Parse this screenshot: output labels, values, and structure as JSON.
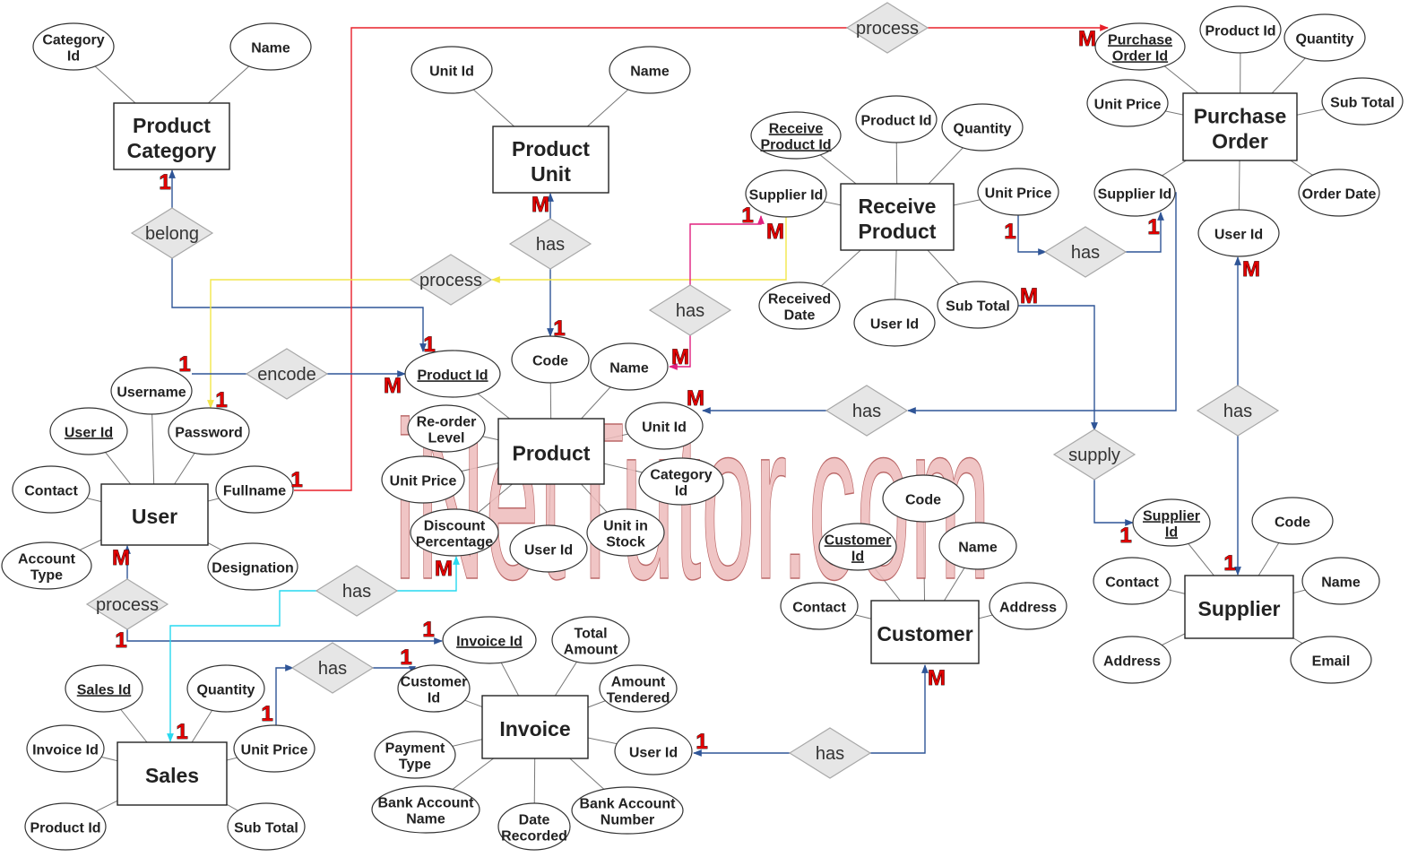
{
  "diagram": {
    "watermark": "iNetTutor.com",
    "colors": {
      "connector": "#2F5597",
      "red_connector": "#E8202A",
      "yellow_connector": "#F2E64A",
      "magenta_connector": "#E0207F",
      "cyan_connector": "#27D9F0",
      "cardinality": "#E00000"
    },
    "entities": [
      {
        "id": "product_category",
        "label": [
          "Product",
          "Category"
        ]
      },
      {
        "id": "product_unit",
        "label": [
          "Product",
          "Unit"
        ]
      },
      {
        "id": "receive_product",
        "label": [
          "Receive",
          "Product"
        ]
      },
      {
        "id": "purchase_order",
        "label": [
          "Purchase",
          "Order"
        ]
      },
      {
        "id": "product",
        "label": [
          "Product"
        ]
      },
      {
        "id": "user",
        "label": [
          "User"
        ]
      },
      {
        "id": "customer",
        "label": [
          "Customer"
        ]
      },
      {
        "id": "supplier",
        "label": [
          "Supplier"
        ]
      },
      {
        "id": "invoice",
        "label": [
          "Invoice"
        ]
      },
      {
        "id": "sales",
        "label": [
          "Sales"
        ]
      }
    ],
    "attributes": [
      {
        "id": "pc_cat_id",
        "entity": "product_category",
        "label": [
          "Category",
          "Id"
        ],
        "key": false
      },
      {
        "id": "pc_name",
        "entity": "product_category",
        "label": [
          "Name"
        ],
        "key": false
      },
      {
        "id": "pu_unit_id",
        "entity": "product_unit",
        "label": [
          "Unit Id"
        ],
        "key": false
      },
      {
        "id": "pu_name",
        "entity": "product_unit",
        "label": [
          "Name"
        ],
        "key": false
      },
      {
        "id": "rp_id",
        "entity": "receive_product",
        "label": [
          "Receive",
          "Product Id"
        ],
        "key": true
      },
      {
        "id": "rp_product_id",
        "entity": "receive_product",
        "label": [
          "Product Id"
        ],
        "key": false
      },
      {
        "id": "rp_qty",
        "entity": "receive_product",
        "label": [
          "Quantity"
        ],
        "key": false
      },
      {
        "id": "rp_supplier_id",
        "entity": "receive_product",
        "label": [
          "Supplier Id"
        ],
        "key": false
      },
      {
        "id": "rp_unit_price",
        "entity": "receive_product",
        "label": [
          "Unit Price"
        ],
        "key": false
      },
      {
        "id": "rp_received_date",
        "entity": "receive_product",
        "label": [
          "Received",
          "Date"
        ],
        "key": false
      },
      {
        "id": "rp_user_id",
        "entity": "receive_product",
        "label": [
          "User Id"
        ],
        "key": false
      },
      {
        "id": "rp_sub_total",
        "entity": "receive_product",
        "label": [
          "Sub Total"
        ],
        "key": false
      },
      {
        "id": "po_id",
        "entity": "purchase_order",
        "label": [
          "Purchase",
          "Order Id"
        ],
        "key": true
      },
      {
        "id": "po_product_id",
        "entity": "purchase_order",
        "label": [
          "Product Id"
        ],
        "key": false
      },
      {
        "id": "po_qty",
        "entity": "purchase_order",
        "label": [
          "Quantity"
        ],
        "key": false
      },
      {
        "id": "po_unit_price",
        "entity": "purchase_order",
        "label": [
          "Unit Price"
        ],
        "key": false
      },
      {
        "id": "po_sub_total",
        "entity": "purchase_order",
        "label": [
          "Sub Total"
        ],
        "key": false
      },
      {
        "id": "po_supplier_id",
        "entity": "purchase_order",
        "label": [
          "Supplier Id"
        ],
        "key": false
      },
      {
        "id": "po_order_date",
        "entity": "purchase_order",
        "label": [
          "Order Date"
        ],
        "key": false
      },
      {
        "id": "po_user_id",
        "entity": "purchase_order",
        "label": [
          "User Id"
        ],
        "key": false
      },
      {
        "id": "p_id",
        "entity": "product",
        "label": [
          "Product Id"
        ],
        "key": true
      },
      {
        "id": "p_code",
        "entity": "product",
        "label": [
          "Code"
        ],
        "key": false
      },
      {
        "id": "p_name",
        "entity": "product",
        "label": [
          "Name"
        ],
        "key": false
      },
      {
        "id": "p_reorder",
        "entity": "product",
        "label": [
          "Re-order",
          "Level"
        ],
        "key": false
      },
      {
        "id": "p_unit_id",
        "entity": "product",
        "label": [
          "Unit Id"
        ],
        "key": false
      },
      {
        "id": "p_unit_price",
        "entity": "product",
        "label": [
          "Unit Price"
        ],
        "key": false
      },
      {
        "id": "p_category_id",
        "entity": "product",
        "label": [
          "Category",
          "Id"
        ],
        "key": false
      },
      {
        "id": "p_discount",
        "entity": "product",
        "label": [
          "Discount",
          "Percentage"
        ],
        "key": false
      },
      {
        "id": "p_user_id",
        "entity": "product",
        "label": [
          "User Id"
        ],
        "key": false
      },
      {
        "id": "p_stock",
        "entity": "product",
        "label": [
          "Unit in",
          "Stock"
        ],
        "key": false
      },
      {
        "id": "u_username",
        "entity": "user",
        "label": [
          "Username"
        ],
        "key": false
      },
      {
        "id": "u_id",
        "entity": "user",
        "label": [
          "User Id"
        ],
        "key": true
      },
      {
        "id": "u_password",
        "entity": "user",
        "label": [
          "Password"
        ],
        "key": false
      },
      {
        "id": "u_contact",
        "entity": "user",
        "label": [
          "Contact"
        ],
        "key": false
      },
      {
        "id": "u_fullname",
        "entity": "user",
        "label": [
          "Fullname"
        ],
        "key": false
      },
      {
        "id": "u_account_type",
        "entity": "user",
        "label": [
          "Account",
          "Type"
        ],
        "key": false
      },
      {
        "id": "u_designation",
        "entity": "user",
        "label": [
          "Designation"
        ],
        "key": false
      },
      {
        "id": "c_code",
        "entity": "customer",
        "label": [
          "Code"
        ],
        "key": false
      },
      {
        "id": "c_id",
        "entity": "customer",
        "label": [
          "Customer",
          "Id"
        ],
        "key": true
      },
      {
        "id": "c_name",
        "entity": "customer",
        "label": [
          "Name"
        ],
        "key": false
      },
      {
        "id": "c_contact",
        "entity": "customer",
        "label": [
          "Contact"
        ],
        "key": false
      },
      {
        "id": "c_address",
        "entity": "customer",
        "label": [
          "Address"
        ],
        "key": false
      },
      {
        "id": "s_supplier_id",
        "entity": "supplier",
        "label": [
          "Supplier",
          "Id"
        ],
        "key": true
      },
      {
        "id": "s_code",
        "entity": "supplier",
        "label": [
          "Code"
        ],
        "key": false
      },
      {
        "id": "s_contact",
        "entity": "supplier",
        "label": [
          "Contact"
        ],
        "key": false
      },
      {
        "id": "s_name",
        "entity": "supplier",
        "label": [
          "Name"
        ],
        "key": false
      },
      {
        "id": "s_address",
        "entity": "supplier",
        "label": [
          "Address"
        ],
        "key": false
      },
      {
        "id": "s_email",
        "entity": "supplier",
        "label": [
          "Email"
        ],
        "key": false
      },
      {
        "id": "i_id",
        "entity": "invoice",
        "label": [
          "Invoice Id"
        ],
        "key": true
      },
      {
        "id": "i_total",
        "entity": "invoice",
        "label": [
          "Total",
          "Amount"
        ],
        "key": false
      },
      {
        "id": "i_customer_id",
        "entity": "invoice",
        "label": [
          "Customer",
          "Id"
        ],
        "key": false
      },
      {
        "id": "i_amount_tendered",
        "entity": "invoice",
        "label": [
          "Amount",
          "Tendered"
        ],
        "key": false
      },
      {
        "id": "i_payment_type",
        "entity": "invoice",
        "label": [
          "Payment",
          "Type"
        ],
        "key": false
      },
      {
        "id": "i_user_id",
        "entity": "invoice",
        "label": [
          "User Id"
        ],
        "key": false
      },
      {
        "id": "i_bank_name",
        "entity": "invoice",
        "label": [
          "Bank Account",
          "Name"
        ],
        "key": false
      },
      {
        "id": "i_date",
        "entity": "invoice",
        "label": [
          "Date",
          "Recorded"
        ],
        "key": false
      },
      {
        "id": "i_bank_number",
        "entity": "invoice",
        "label": [
          "Bank Account",
          "Number"
        ],
        "key": false
      },
      {
        "id": "sa_id",
        "entity": "sales",
        "label": [
          "Sales Id"
        ],
        "key": true
      },
      {
        "id": "sa_qty",
        "entity": "sales",
        "label": [
          "Quantity"
        ],
        "key": false
      },
      {
        "id": "sa_invoice_id",
        "entity": "sales",
        "label": [
          "Invoice Id"
        ],
        "key": false
      },
      {
        "id": "sa_unit_price",
        "entity": "sales",
        "label": [
          "Unit Price"
        ],
        "key": false
      },
      {
        "id": "sa_product_id",
        "entity": "sales",
        "label": [
          "Product Id"
        ],
        "key": false
      },
      {
        "id": "sa_sub_total",
        "entity": "sales",
        "label": [
          "Sub Total"
        ],
        "key": false
      }
    ],
    "relationships": [
      {
        "id": "r_belong",
        "label": "belong"
      },
      {
        "id": "r_process_top",
        "label": "process"
      },
      {
        "id": "r_has_unit",
        "label": "has"
      },
      {
        "id": "r_process_yellow",
        "label": "process"
      },
      {
        "id": "r_has_magenta",
        "label": "has"
      },
      {
        "id": "r_encode",
        "label": "encode"
      },
      {
        "id": "r_has_rp",
        "label": "has"
      },
      {
        "id": "r_has_unitid",
        "label": "has"
      },
      {
        "id": "r_supply",
        "label": "supply"
      },
      {
        "id": "r_has_supplier",
        "label": "has"
      },
      {
        "id": "r_process_user",
        "label": "process"
      },
      {
        "id": "r_has_cyan",
        "label": "has"
      },
      {
        "id": "r_has_sales",
        "label": "has"
      },
      {
        "id": "r_has_customer",
        "label": "has"
      }
    ],
    "cardinalities": [
      "1",
      "1",
      "1",
      "M",
      "M",
      "1",
      "1",
      "1",
      "M",
      "M",
      "1",
      "M",
      "1",
      "1",
      "M",
      "M",
      "1",
      "M",
      "1",
      "M",
      "1",
      "1",
      "1",
      "M",
      "1",
      "1",
      "1",
      "M",
      "M",
      "1"
    ]
  }
}
